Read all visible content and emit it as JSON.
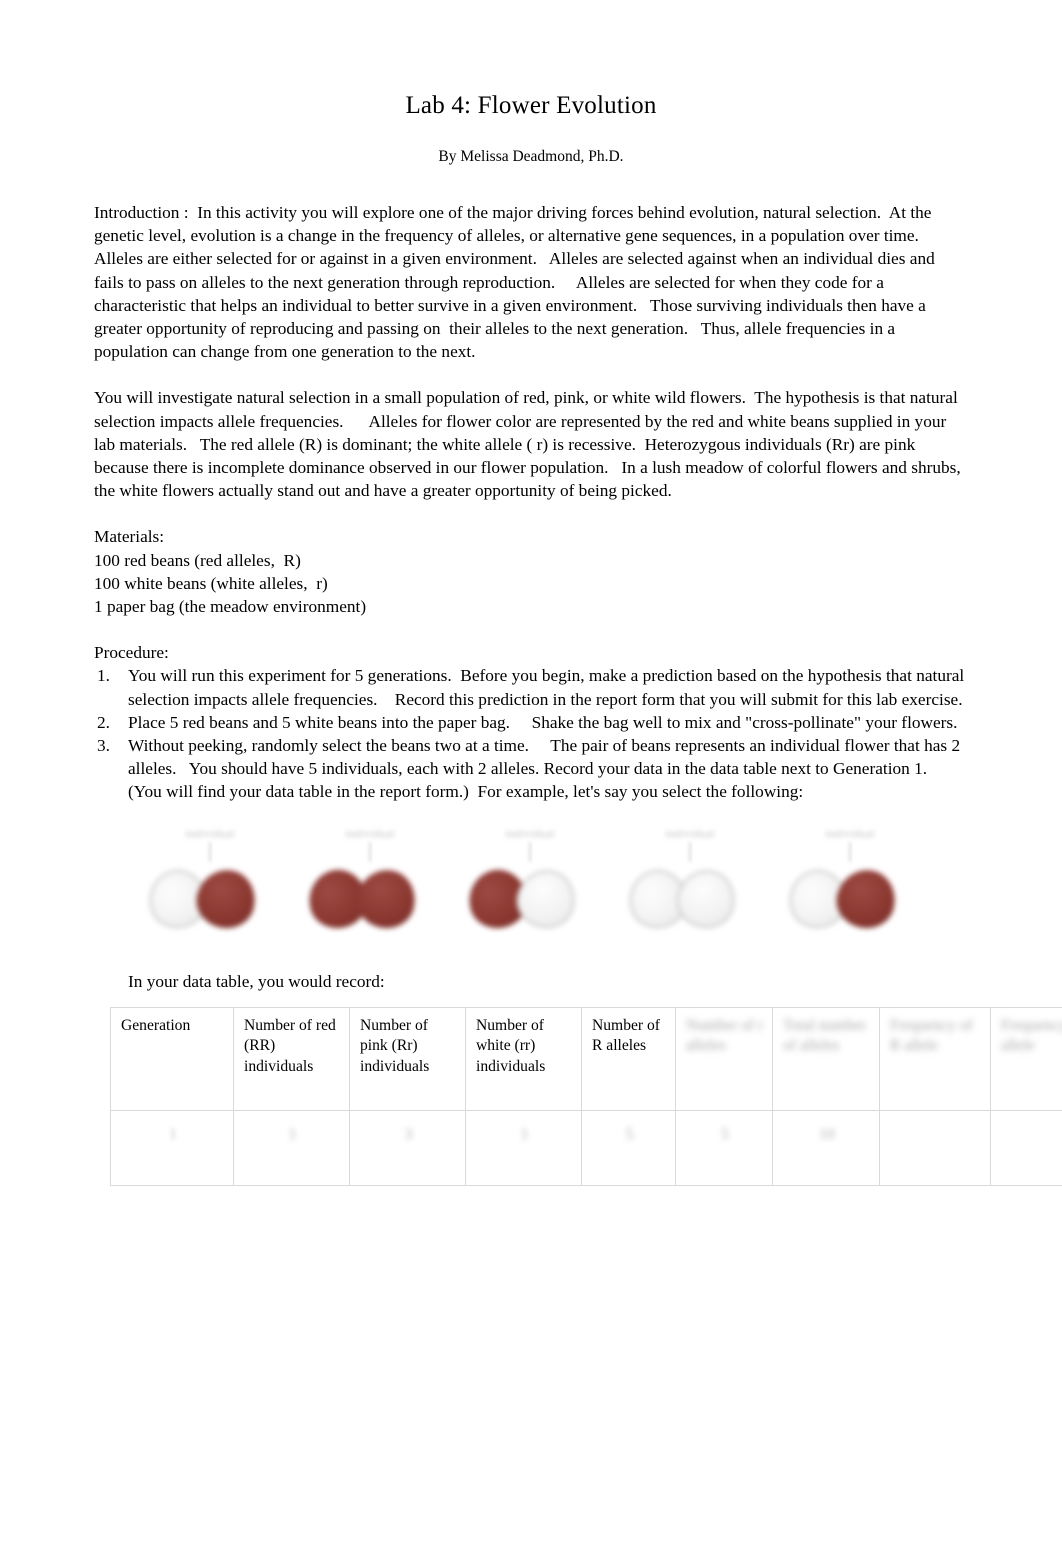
{
  "document": {
    "title": "Lab 4: Flower Evolution",
    "byline": "By Melissa Deadmond, Ph.D."
  },
  "introduction": {
    "text": "Introduction :  In this activity you will explore one of the major driving forces behind evolution, natural selection.  At the genetic level, evolution is a change in the frequency of alleles, or alternative gene sequences, in a population over time.   Alleles are either selected for or against in a given environment.   Alleles are selected against when an individual dies and fails to pass on alleles to the next generation through reproduction.     Alleles are selected for when they code for a characteristic that helps an individual to better survive in a given environment.   Those surviving individuals then have a greater opportunity of reproducing and passing on  their alleles to the next generation.   Thus, allele frequencies in a population can change from one generation to the next."
  },
  "hypothesis_paragraph": {
    "text": "You will investigate natural selection in a small population of red, pink, or white wild flowers.  The hypothesis is that natural selection impacts allele frequencies.      Alleles for flower color are represented by the red and white beans supplied in your lab materials.   The red allele (R) is dominant; the white allele ( r) is recessive.  Heterozygous individuals (Rr) are pink because there is incomplete dominance observed in our flower population.   In a lush meadow of colorful flowers and shrubs, the white flowers actually stand out and have a greater opportunity of being picked."
  },
  "materials": {
    "heading": "Materials:",
    "items": [
      "100 red beans (red alleles,  R)",
      "100 white beans (white alleles,  r)",
      "1 paper bag (the meadow environment)"
    ]
  },
  "procedure": {
    "heading": "Procedure:",
    "steps": [
      {
        "number": "1.",
        "text": "You will run this experiment for 5 generations.  Before you begin, make a prediction based on the hypothesis that natural selection impacts allele frequencies.    Record this prediction in the report form that you will submit for this lab exercise."
      },
      {
        "number": "2.",
        "text": "Place 5 red beans and 5 white beans into the paper bag.     Shake the bag well to mix and \"cross-pollinate\" your flowers."
      },
      {
        "number": "3.",
        "text": "Without peeking, randomly select the beans two at a time.     The pair of beans represents an individual flower that has 2 alleles.   You should have 5 individuals, each with 2 alleles. Record your data in the data table next to Generation 1.  (You will find your data table in the report form.)  For example, let's say you select the following:"
      }
    ]
  },
  "bean_figure": {
    "groups": [
      {
        "label": "individual",
        "left_bean": "white",
        "right_bean": "red"
      },
      {
        "label": "individual",
        "left_bean": "red",
        "right_bean": "red"
      },
      {
        "label": "individual",
        "left_bean": "red",
        "right_bean": "white"
      },
      {
        "label": "individual",
        "left_bean": "white",
        "right_bean": "white"
      },
      {
        "label": "individual",
        "left_bean": "white",
        "right_bean": "red"
      }
    ],
    "red_color": "#8a3730",
    "white_color": "#f2f2f2"
  },
  "caption": {
    "text": "In your data table, you would record:"
  },
  "data_table": {
    "headers": [
      "Generation",
      "Number of red (RR) individuals",
      "Number of pink (Rr) individuals",
      "Number of white (rr) individuals",
      "Number of R alleles",
      "Number of r alleles",
      "Total number of alleles",
      "Frequency of R allele",
      "Frequency of r allele"
    ],
    "rows": [
      [
        "1",
        "1",
        "3",
        "1",
        "5",
        "5",
        "10",
        "",
        ""
      ]
    ]
  }
}
